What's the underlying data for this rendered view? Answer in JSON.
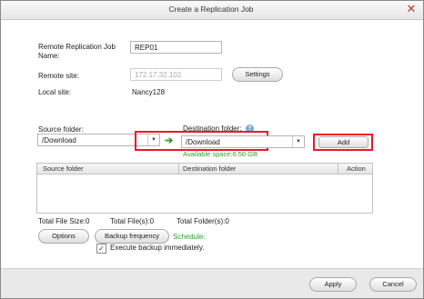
{
  "dialog": {
    "title": "Create a Replication Job",
    "close_glyph": "✕"
  },
  "form": {
    "job_name_label_line1": "Remote Replication Job",
    "job_name_label_line2": "Name:",
    "job_name_value": "REP01",
    "remote_site_label": "Remote site:",
    "remote_site_value": "172.17.32.102",
    "settings_button": "Settings",
    "local_site_label": "Local site:",
    "local_site_value": "Nancy128",
    "source_folder_label": "Source folder:",
    "source_folder_value": "/Download",
    "destination_folder_label": "Destination folder:",
    "destination_folder_value": "/Download",
    "available_space": "Available space:6.50 GB",
    "add_button": "Add",
    "arrow_glyph": "➔",
    "dropdown_glyph": "▼",
    "help_glyph": "?"
  },
  "table": {
    "columns": [
      "Source folder",
      "Destination folder",
      "Action"
    ],
    "rows": []
  },
  "totals": {
    "file_size": "Total File Size:0",
    "files": "Total File(s):0",
    "folders": "Total Folder(s):0"
  },
  "options": {
    "options_button": "Options",
    "backup_frequency_button": "Backup frequency",
    "schedule_label": "Schedule:",
    "execute_immediately_label": "Execute backup immediately.",
    "execute_immediately_checked": true,
    "check_glyph": "✓"
  },
  "footer": {
    "apply_button": "Apply",
    "cancel_button": "Cancel"
  },
  "colors": {
    "highlight": "#e8192c",
    "green": "#2f9e2f"
  }
}
